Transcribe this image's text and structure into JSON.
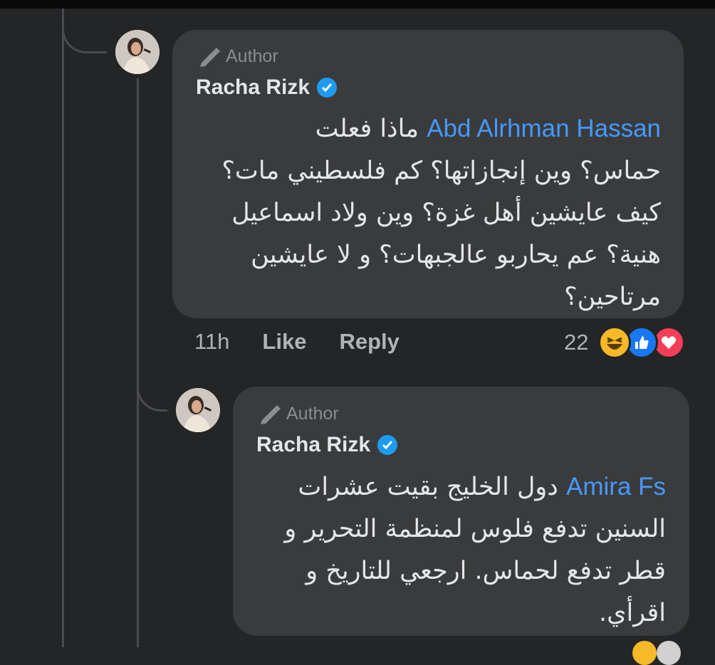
{
  "comment": {
    "author_tag": "Author",
    "name": "Racha Rizk",
    "mention": "Abd Alrhman Hassan",
    "lines": [
      "ماذا فعلت",
      "حماس؟ وين إنجازاتها؟ كم فلسطيني مات؟",
      "كيف عايشين أهل غزة؟ وين ولاد اسماعيل",
      "هنية؟ عم يحاربو عالجبهات؟ و لا عايشين",
      "مرتاحين؟"
    ],
    "time": "11h",
    "like_label": "Like",
    "reply_label": "Reply",
    "reaction_count": "22"
  },
  "reply": {
    "author_tag": "Author",
    "name": "Racha Rizk",
    "mention": "Amira Fs",
    "lines": [
      "دول الخليج بقيت عشرات",
      "السنين تدفع فلوس لمنظمة التحرير و",
      "قطر تدفع لحماس. ارجعي للتاريخ و",
      "اقرأي."
    ]
  },
  "colors": {
    "background": "#242526",
    "bubble": "#3a3b3c",
    "mention": "#4599ff",
    "verified": "#1d9bf0",
    "like": "#1877f2",
    "love": "#f33e58",
    "haha": "#f7b928"
  },
  "icons": [
    "pen-icon",
    "verified-badge-icon",
    "haha-reaction-icon",
    "like-reaction-icon",
    "love-reaction-icon"
  ]
}
